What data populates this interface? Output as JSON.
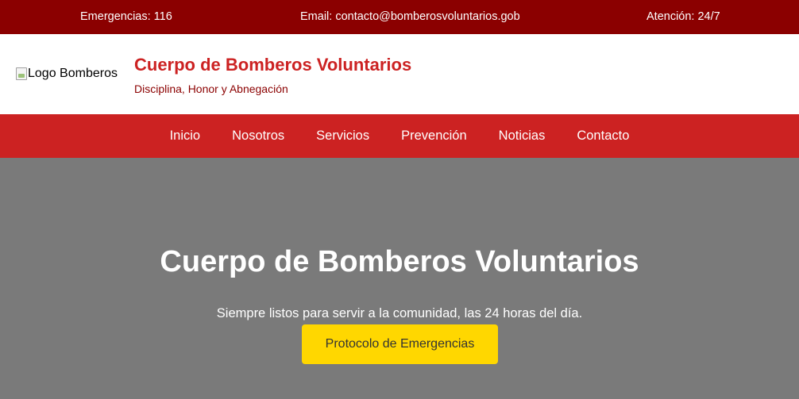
{
  "topbar": {
    "emergencies": "Emergencias: 116",
    "email": "Email: contacto@bomberosvoluntarios.gob",
    "hours": "Atención: 24/7"
  },
  "header": {
    "logo_alt": "Logo Bomberos",
    "title": "Cuerpo de Bomberos Voluntarios",
    "motto": "Disciplina, Honor y Abnegación"
  },
  "nav": {
    "items": [
      {
        "label": "Inicio"
      },
      {
        "label": "Nosotros"
      },
      {
        "label": "Servicios"
      },
      {
        "label": "Prevención"
      },
      {
        "label": "Noticias"
      },
      {
        "label": "Contacto"
      }
    ]
  },
  "hero": {
    "title": "Cuerpo de Bomberos Voluntarios",
    "text": "Siempre listos para servir a la comunidad, las 24 horas del día.",
    "button_label": "Protocolo de Emergencias"
  },
  "colors": {
    "topbar_bg": "#8b0000",
    "primary_red": "#cc2222",
    "hero_bg": "#7a7a7a",
    "button_yellow": "#ffd700"
  },
  "icons": {
    "logo": "broken-image-icon"
  }
}
